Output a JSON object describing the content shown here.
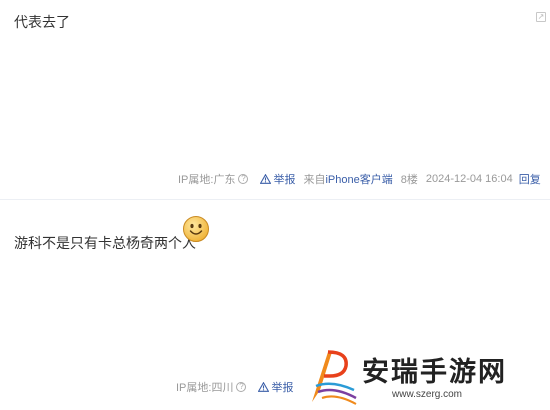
{
  "posts": [
    {
      "text": "代表去了",
      "ip_label": "IP属地:",
      "ip_location": "广东",
      "report_label": "举报",
      "source_prefix": "来自",
      "source_client": "iPhone客户端",
      "floor": "8楼",
      "time": "2024-12-04 16:04",
      "reply_label": "回复"
    },
    {
      "text": "游科不是只有卡总杨奇两个人",
      "ip_label": "IP属地:",
      "ip_location": "四川",
      "report_label": "举报"
    }
  ],
  "watermark": {
    "title": "安瑞手游网",
    "url": "www.szerg.com"
  },
  "icons": {
    "help": "question-circle-icon",
    "warning": "warning-triangle-icon",
    "emoji": "smiley-face-emoji",
    "corner": "expand-icon"
  },
  "colors": {
    "link": "#3a5ea8",
    "meta": "#999999",
    "divider": "#eceff4"
  }
}
